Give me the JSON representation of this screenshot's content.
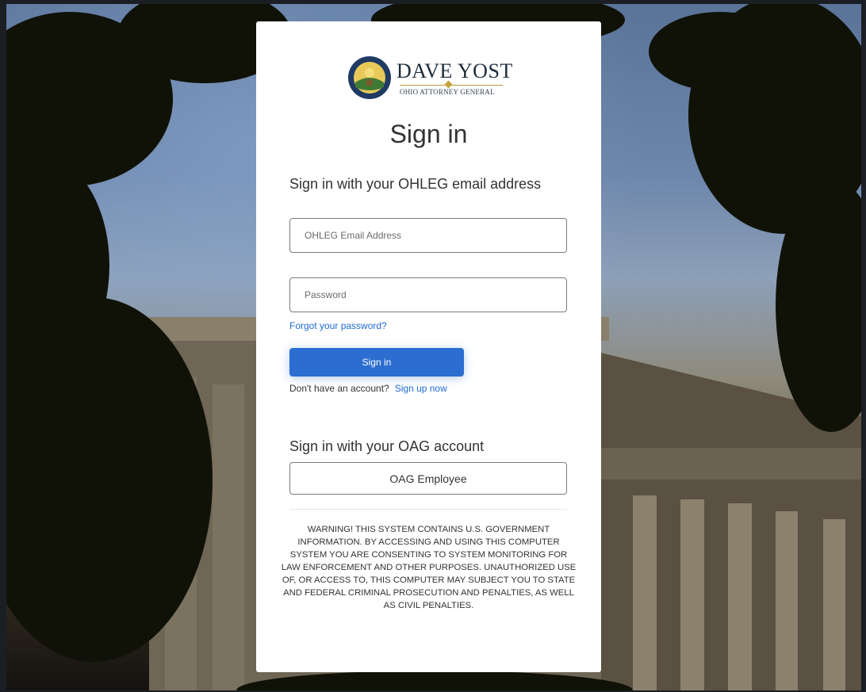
{
  "logo": {
    "name": "DAVE YOST",
    "subtitle": "OHIO ATTORNEY GENERAL"
  },
  "page": {
    "title": "Sign in",
    "local_heading": "Sign in with your OHLEG email address",
    "email_placeholder": "OHLEG Email Address",
    "password_placeholder": "Password",
    "forgot_link": "Forgot your password?",
    "signin_button": "Sign in",
    "no_account_text": "Don't have an account?",
    "signup_link": "Sign up now",
    "oag_heading": "Sign in with your OAG account",
    "oag_button": "OAG Employee",
    "warning": "WARNING! THIS SYSTEM CONTAINS U.S. GOVERNMENT INFORMATION. BY ACCESSING AND USING THIS COMPUTER SYSTEM YOU ARE CONSENTING TO SYSTEM MONITORING FOR LAW ENFORCEMENT AND OTHER PURPOSES. UNAUTHORIZED USE OF, OR ACCESS TO, THIS COMPUTER MAY SUBJECT YOU TO STATE AND FEDERAL CRIMINAL PROSECUTION AND PENALTIES, AS WELL AS CIVIL PENALTIES."
  },
  "colors": {
    "primary_button": "#2c6dd1",
    "link": "#1f6bd2",
    "card_background": "#ffffff",
    "logo_gold": "#c6a43c"
  },
  "icons": {
    "seal": "ohio-attorney-general-seal-icon"
  }
}
